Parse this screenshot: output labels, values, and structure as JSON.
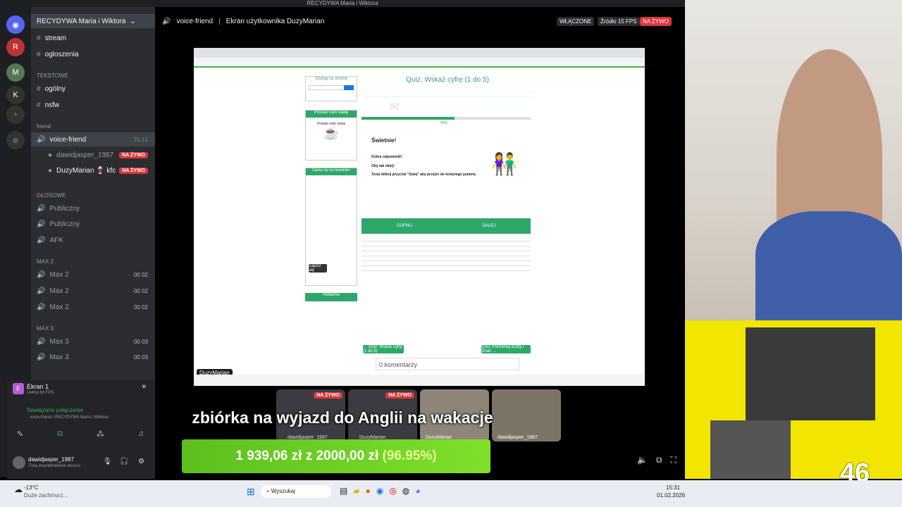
{
  "window": {
    "title": "RECYDYWA Maria i Wiktora"
  },
  "server": {
    "name": "RECYDYWA Maria i Wiktora"
  },
  "channels": {
    "text": [
      {
        "label": "stream"
      },
      {
        "label": "ogloszenia"
      }
    ],
    "text_category": "TEKSTOWE",
    "text2": [
      {
        "label": "ogólny"
      },
      {
        "label": "nsfw"
      }
    ],
    "friend_category": "friend",
    "voice_friend": {
      "label": "voice-friend",
      "time": "25:12"
    },
    "members": [
      {
        "name": "dawidjasper_1987",
        "badge": "NA ŻYWO"
      },
      {
        "name": "DuzyMarian 🍷 kfc",
        "badge": "NA ŻYWO"
      }
    ],
    "voice_category": "GŁOSOWE",
    "voice": [
      {
        "label": "Publiczny"
      },
      {
        "label": "Publiczny"
      },
      {
        "label": "AFK"
      }
    ],
    "max2_category": "MAX 2",
    "max2": [
      {
        "label": "Max 2",
        "count": "00 02"
      },
      {
        "label": "Max 2",
        "count": "00 02"
      },
      {
        "label": "Max 2",
        "count": "00 02"
      }
    ],
    "max3_category": "MAX 3",
    "max3": [
      {
        "label": "Max 3",
        "count": "00 03"
      },
      {
        "label": "Max 3",
        "count": "00 03"
      },
      {
        "label": "Max 3",
        "count": ""
      }
    ]
  },
  "stream_panel": {
    "title": "Ekran 1",
    "subtitle": "1440p 60 FPS"
  },
  "connection": {
    "status": "Nawiązano połączenie",
    "location": "voice-friend / RECYDYWA Maria i Wiktora"
  },
  "user": {
    "name": "dawidjasper_1987",
    "status": "Trwa współdzielenie ekranu"
  },
  "topbar": {
    "channel": "voice-friend",
    "stream_label": "Ekran użytkownika DuzyMarian",
    "enabled": "WŁĄCZONE",
    "source": "Źródło 15 FPS",
    "live": "NA ŻYWO"
  },
  "screen": {
    "search_title": "Szukaj na stronie",
    "coffee_title": "Postaw nam kawę",
    "coffee_text": "Postaw nam kawę",
    "newsletter_title": "Zapisz się na newsletter",
    "newsletter_button": "Zapisz się",
    "ad_title": "Reklama",
    "quiz_title": "Quiz: Wskaż cyfrę (1 do 5)",
    "progress_text": "55%",
    "progress": 0.55,
    "great": "Świetnie!",
    "good_answer": "Dobra odpowiedź!",
    "keep_going": "Oby tak dalej!",
    "next_hint": "Teraz kliknij przycisk \"Dalej\" aby przejść do kolejnego pytania.",
    "back_btn": "COFNIJ",
    "next_btn": "DALEJ",
    "prev_quiz": "← Quiz: Wskaż cyfrę (1 do 5)",
    "next_quiz": "Quiz: Porównaj liczby i znaki →",
    "comments": "0 komentarzy",
    "overlay_name": "DuzyMarian"
  },
  "tiles": [
    {
      "label": "dawidjasper_1987",
      "badge": "NA ŻYWO"
    },
    {
      "label": "DuzyMarian",
      "badge": "NA ŻYWO"
    },
    {
      "label": "DuzyMarian",
      "badge": ""
    },
    {
      "label": "dawidjasper_1987",
      "badge": ""
    }
  ],
  "caption": "zbiórka na wyjazd do Anglii na wakacje",
  "fundraiser": {
    "raised": "1 939,06 zł",
    "of": "z",
    "goal": "2000,00 zł",
    "pct": "(96.95%)",
    "progress": 0.9695
  },
  "overlay_number": "46",
  "taskbar": {
    "weather_temp": "-13°C",
    "weather_desc": "Duże zachmurz...",
    "search": "Wyszukaj",
    "time": "15:31",
    "date": "01.02.2026"
  }
}
